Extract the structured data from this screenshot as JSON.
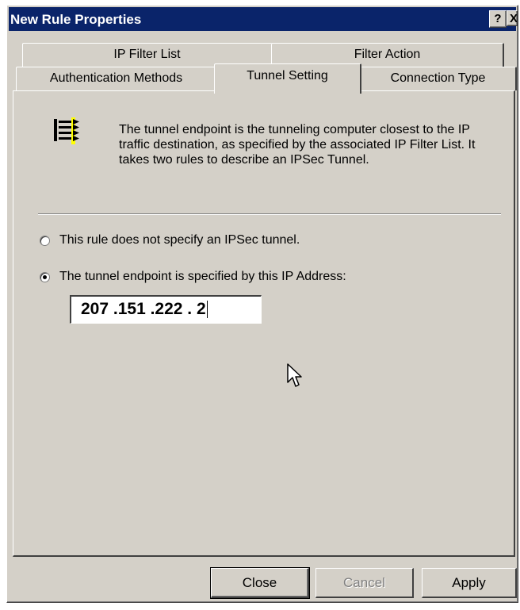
{
  "window": {
    "title": "New Rule Properties",
    "help_glyph": "?",
    "close_glyph": "X"
  },
  "tabs": {
    "row1": [
      {
        "label": "IP Filter List"
      },
      {
        "label": "Filter Action"
      }
    ],
    "row2": [
      {
        "label": "Authentication Methods"
      },
      {
        "label": "Tunnel Setting",
        "selected": true
      },
      {
        "label": "Connection Type"
      }
    ]
  },
  "panel": {
    "icon": "tunnel-icon",
    "description": "The tunnel endpoint is the tunneling computer closest to the IP traffic destination, as specified by the associated IP Filter List. It takes two rules to describe an IPSec Tunnel.",
    "options": [
      {
        "label": "This rule does not specify an IPSec tunnel.",
        "checked": false
      },
      {
        "label": "The tunnel endpoint is specified by this IP Address:",
        "checked": true
      }
    ],
    "ip_address": "207 .151 .222 .  2"
  },
  "buttons": {
    "close": "Close",
    "cancel": "Cancel",
    "apply": "Apply"
  },
  "colors": {
    "title_bar": "#0a246a",
    "face": "#d4d0c8",
    "disabled_text": "#808080"
  }
}
